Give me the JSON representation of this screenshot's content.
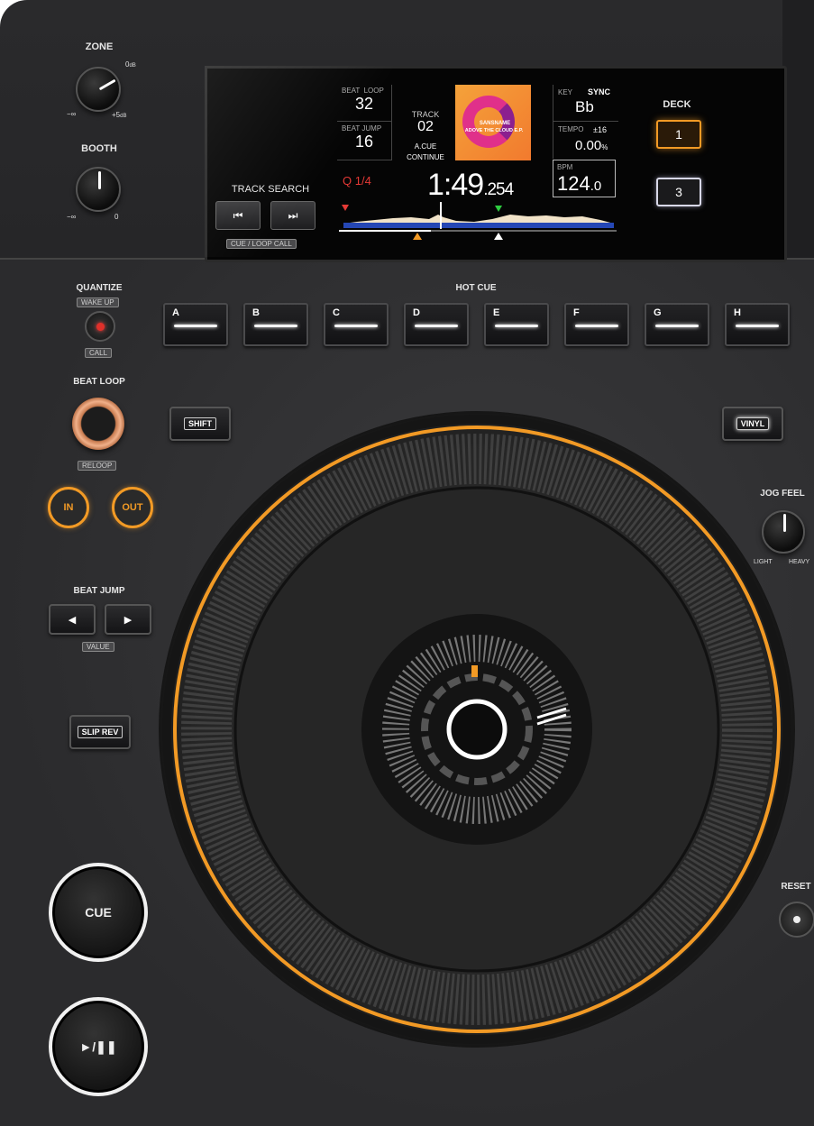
{
  "top": {
    "zone": {
      "label": "ZONE",
      "min": "−∞",
      "zero": "0",
      "zero_unit": "dB",
      "max": "+5",
      "max_unit": "dB"
    },
    "booth": {
      "label": "BOOTH",
      "min": "−∞",
      "max": "0"
    },
    "track_search": {
      "label": "TRACK SEARCH",
      "prev_icon": "⏮",
      "next_icon": "⏭",
      "sub_label": "CUE / LOOP CALL"
    },
    "deck": {
      "label": "DECK",
      "deck1": "1",
      "deck3": "3"
    }
  },
  "screen": {
    "beat_loop": {
      "label": "BEAT  LOOP",
      "value": "32"
    },
    "beat_jump": {
      "label": "BEAT JUMP",
      "value": "16"
    },
    "quantize": {
      "value": "Q 1/4"
    },
    "track": {
      "label": "TRACK",
      "value": "02"
    },
    "auto_cue": {
      "line1": "A.CUE",
      "line2": "CONTINUE"
    },
    "artwork": {
      "artist": "SANSNAME",
      "title": "ADOVE THE CLOUD E.P."
    },
    "key": {
      "label": "KEY",
      "sync": "SYNC",
      "value": "Bb"
    },
    "tempo": {
      "label": "TEMPO",
      "range": "±16",
      "value": "0.00",
      "unit": "%"
    },
    "bpm": {
      "label": "BPM",
      "value": "124",
      "decimal": ".0"
    },
    "time": {
      "main": "1:49",
      "ms": ".254"
    },
    "progress_fraction": 0.33
  },
  "controls": {
    "quantize": {
      "label": "QUANTIZE",
      "above": "WAKE UP",
      "below": "CALL"
    },
    "hot_cue": {
      "label": "HOT CUE",
      "pads": [
        "A",
        "B",
        "C",
        "D",
        "E",
        "F",
        "G",
        "H"
      ]
    },
    "beat_loop": {
      "label": "BEAT LOOP",
      "below": "RELOOP"
    },
    "loop_in": "IN",
    "loop_out": "OUT",
    "shift": "SHIFT",
    "vinyl": "VINYL",
    "jog_feel": {
      "label": "JOG FEEL",
      "light": "LIGHT",
      "heavy": "HEAVY"
    },
    "beat_jump": {
      "label": "BEAT JUMP",
      "left": "◀",
      "right": "▶",
      "below": "VALUE"
    },
    "slip_rev": "SLIP REV",
    "cue": "CUE",
    "play": "►/❚❚",
    "reset": "RESET"
  },
  "colors": {
    "accent_orange": "#f29a25",
    "panel": "#2e2e30",
    "screen_bg": "#050505"
  }
}
